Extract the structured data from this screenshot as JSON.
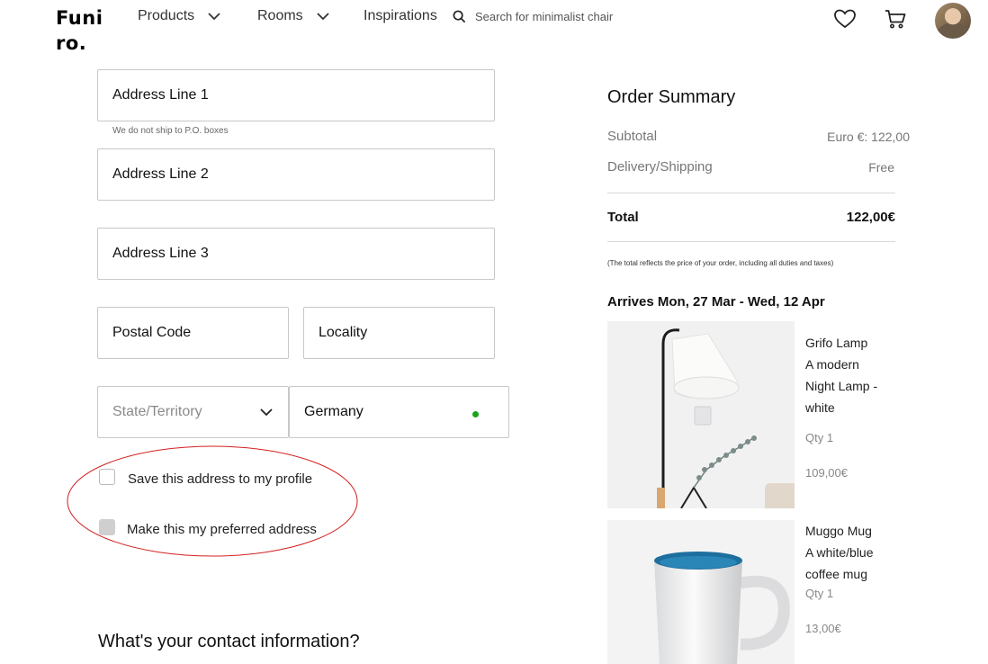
{
  "header": {
    "logo_line1": "Funi",
    "logo_line2": "ro.",
    "nav": {
      "products": "Products",
      "rooms": "Rooms",
      "inspirations": "Inspirations"
    },
    "search_placeholder": "Search for minimalist chair",
    "icons": [
      "search-icon",
      "heart-icon",
      "cart-icon",
      "avatar"
    ]
  },
  "form": {
    "address1": "Address Line 1",
    "address1_hint": "We do not ship to P.O. boxes",
    "address2": "Address Line 2",
    "address3": "Address Line 3",
    "postal": "Postal Code",
    "locality": "Locality",
    "state": "State/Territory",
    "country": "Germany",
    "save_address": "Save this address to my profile",
    "preferred_address": "Make this my preferred address",
    "contact_heading": "What's your contact information?"
  },
  "summary": {
    "title": "Order Summary",
    "subtotal_label": "Subtotal",
    "subtotal_value": "Euro €: 122,00",
    "shipping_label": "Delivery/Shipping",
    "shipping_value": "Free",
    "total_label": "Total",
    "total_value": "122,00€",
    "note": "(The total reflects the price of your order, including all duties and taxes)",
    "arrives": "Arrives Mon, 27 Mar - Wed, 12 Apr",
    "items": [
      {
        "name_lines": [
          "Grifo Lamp",
          "A modern",
          "Night Lamp -",
          "white"
        ],
        "qty": "Qty 1",
        "price": "109,00€"
      },
      {
        "name_lines": [
          "Muggo Mug",
          "A white/blue",
          "coffee mug"
        ],
        "qty": "Qty 1",
        "price": "13,00€"
      }
    ]
  },
  "colors": {
    "annotation_circle": "#d42020",
    "status_dot": "#1aa31a"
  }
}
